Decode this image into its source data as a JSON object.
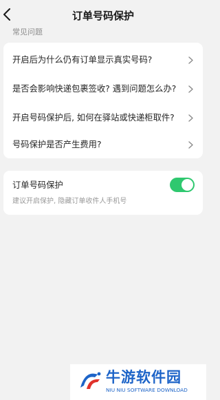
{
  "header": {
    "title": "订单号码保护",
    "back_icon": "chevron-left-icon"
  },
  "faq": {
    "section_label": "常见问题",
    "items": [
      {
        "label": "开启后为什么仍有订单显示真实号码?"
      },
      {
        "label": "是否会影响快递包裹签收? 遇到问题怎么办?"
      },
      {
        "label": "开启号码保护后, 如何在驿站或快递柜取件?"
      },
      {
        "label": "号码保护是否产生费用?"
      }
    ],
    "chevron_icon": "chevron-right-icon"
  },
  "protection": {
    "title": "订单号码保护",
    "description": "建议开启保护, 隐藏订单收件人手机号",
    "enabled": true,
    "accent_color": "#2fc86f"
  },
  "watermark": {
    "title": "牛游软件园",
    "subtitle": "NIU NIU SOFTWARE DOWNLOAD",
    "color": "#1d64c8"
  }
}
